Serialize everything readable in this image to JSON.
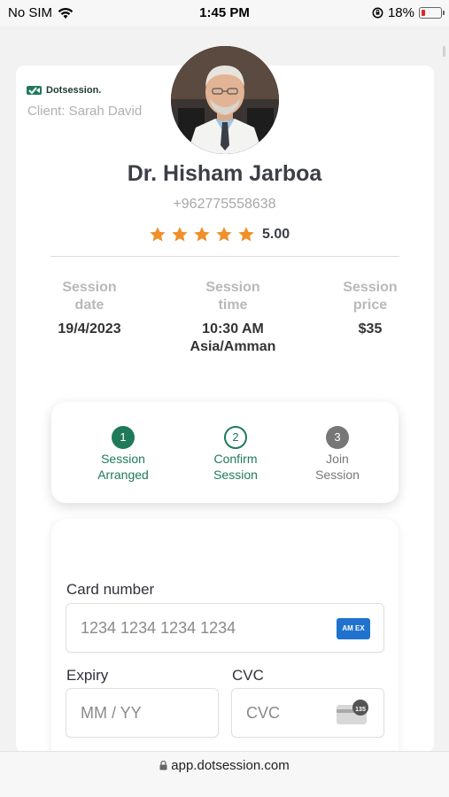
{
  "status_bar": {
    "carrier": "No SIM",
    "time": "1:45 PM",
    "battery": "18%",
    "battery_level": 0.18,
    "wifi_icon": "wifi-icon",
    "lock_rotation_icon": "orientation-lock-icon"
  },
  "brand": {
    "name": "Dotsession.",
    "icon": "dotsession-logo-icon",
    "color": "#1f7a5a"
  },
  "client_line": "Client: Sarah David",
  "doctor": {
    "name": "Dr. Hisham Jarboa",
    "phone": "+962775558638",
    "rating": "5.00",
    "stars": 5,
    "star_color": "#f0902a"
  },
  "session": {
    "date_label_line1": "Session",
    "date_label_line2": "date",
    "date_value": "19/4/2023",
    "time_label_line1": "Session",
    "time_label_line2": "time",
    "time_value_line1": "10:30 AM",
    "time_value_line2": "Asia/Amman",
    "price_label_line1": "Session",
    "price_label_line2": "price",
    "price_value": "$35"
  },
  "steps": [
    {
      "number": "1",
      "line1": "Session",
      "line2": "Arranged",
      "state": "done"
    },
    {
      "number": "2",
      "line1": "Confirm",
      "line2": "Session",
      "state": "current"
    },
    {
      "number": "3",
      "line1": "Join",
      "line2": "Session",
      "state": "pending"
    }
  ],
  "payment": {
    "card_number_label": "Card number",
    "card_number_placeholder": "1234 1234 1234 1234",
    "card_brand_icon": "amex-card-icon",
    "expiry_label": "Expiry",
    "expiry_placeholder": "MM / YY",
    "cvc_label": "CVC",
    "cvc_placeholder": "CVC",
    "cvc_icon": "cvc-card-icon",
    "cvc_icon_text": "135",
    "amex_text": "AM EX"
  },
  "browser": {
    "url": "app.dotsession.com",
    "lock_icon": "lock-icon"
  },
  "colors": {
    "accent": "#1f7a5a",
    "step_pending": "#777777"
  }
}
